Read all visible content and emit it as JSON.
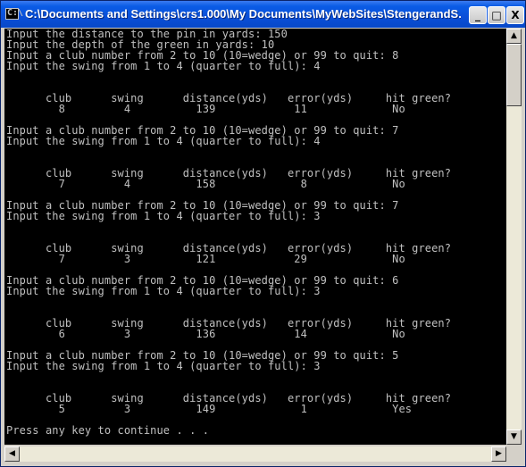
{
  "window": {
    "title": "C:\\Documents and Settings\\crs1.000\\My Documents\\MyWebSites\\StengerandS...",
    "icon_glyph": "C:\\",
    "controls": {
      "minimize": "_",
      "maximize": "□",
      "close": "X"
    }
  },
  "console": {
    "lines": [
      "Input the distance to the pin in yards: 150",
      "Input the depth of the green in yards: 10",
      "Input a club number from 2 to 10 (10=wedge) or 99 to quit: 8",
      "Input the swing from 1 to 4 (quarter to full): 4",
      "",
      "",
      "      club      swing      distance(yds)   error(yds)     hit green?",
      "        8         4          139            11             No",
      "",
      "Input a club number from 2 to 10 (10=wedge) or 99 to quit: 7",
      "Input the swing from 1 to 4 (quarter to full): 4",
      "",
      "",
      "      club      swing      distance(yds)   error(yds)     hit green?",
      "        7         4          158             8             No",
      "",
      "Input a club number from 2 to 10 (10=wedge) or 99 to quit: 7",
      "Input the swing from 1 to 4 (quarter to full): 3",
      "",
      "",
      "      club      swing      distance(yds)   error(yds)     hit green?",
      "        7         3          121            29             No",
      "",
      "Input a club number from 2 to 10 (10=wedge) or 99 to quit: 6",
      "Input the swing from 1 to 4 (quarter to full): 3",
      "",
      "",
      "      club      swing      distance(yds)   error(yds)     hit green?",
      "        6         3          136            14             No",
      "",
      "Input a club number from 2 to 10 (10=wedge) or 99 to quit: 5",
      "Input the swing from 1 to 4 (quarter to full): 3",
      "",
      "",
      "      club      swing      distance(yds)   error(yds)     hit green?",
      "        5         3          149             1             Yes",
      "",
      "Press any key to continue . . ."
    ]
  },
  "scrollbars": {
    "up_arrow": "▲",
    "down_arrow": "▼",
    "left_arrow": "◀",
    "right_arrow": "▶"
  },
  "colors": {
    "console_bg": "#000000",
    "console_text": "#c0c0c0",
    "titlebar": "#0a4fd8"
  }
}
